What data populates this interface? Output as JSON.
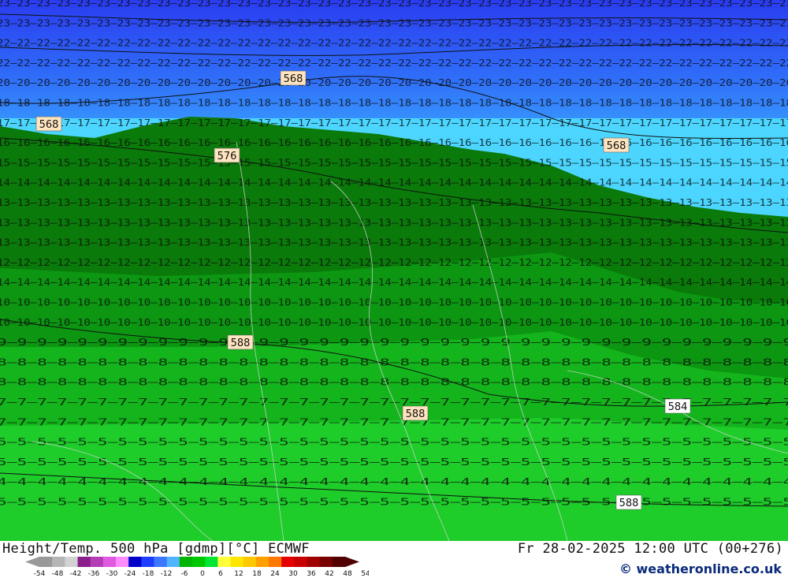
{
  "map": {
    "labels": [
      "568",
      "568",
      "576",
      "568",
      "588",
      "588",
      "584",
      "588"
    ],
    "field_row_numbers": [
      "23",
      "23",
      "22",
      "22",
      "20",
      "18",
      "17",
      "16",
      "15",
      "14",
      "13",
      "13",
      "13",
      "12",
      "14",
      "10",
      "10",
      "9",
      "8",
      "8",
      "7",
      "7",
      "5",
      "5",
      "4",
      "5"
    ]
  },
  "footer": {
    "title_left": "Height/Temp. 500 hPa [gdmp][°C] ECMWF",
    "title_right": "Fr 28-02-2025 12:00 UTC (00+276)",
    "credit": "© weatheronline.co.uk"
  },
  "legend": {
    "ticks": [
      "-54",
      "-48",
      "-42",
      "-36",
      "-30",
      "-24",
      "-18",
      "-12",
      "-6",
      "0",
      "6",
      "12",
      "18",
      "24",
      "30",
      "36",
      "42",
      "48",
      "54"
    ],
    "colors": [
      "#999999",
      "#b5b5b5",
      "#d2d2d2",
      "#8a1e8a",
      "#b43cb4",
      "#e05ae0",
      "#ff8cff",
      "#0000c8",
      "#1e3cff",
      "#3c78ff",
      "#50b4ff",
      "#00b400",
      "#00c800",
      "#00e632",
      "#ffff3c",
      "#ffe600",
      "#ffc800",
      "#ffa000",
      "#ff7800",
      "#e60000",
      "#c80000",
      "#a00000",
      "#780000",
      "#500000"
    ]
  }
}
